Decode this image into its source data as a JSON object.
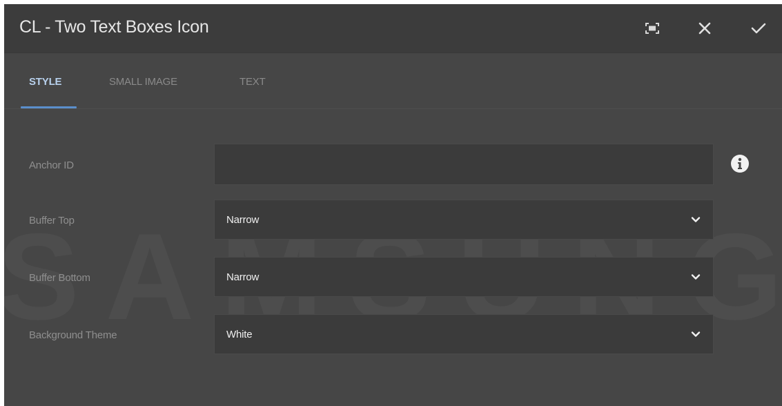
{
  "dialog": {
    "title": "CL - Two Text Boxes Icon",
    "actions": [
      {
        "name": "fullscreen",
        "icon": "fullscreen-icon"
      },
      {
        "name": "close",
        "icon": "close-icon"
      },
      {
        "name": "done",
        "icon": "checkmark-icon"
      }
    ]
  },
  "tabs": [
    {
      "label": "STYLE",
      "active": true
    },
    {
      "label": "SMALL IMAGE",
      "active": false
    },
    {
      "label": "TEXT",
      "active": false
    }
  ],
  "form": {
    "anchor_id": {
      "label": "Anchor ID",
      "value": "",
      "info_icon": "info-icon"
    },
    "buffer_top": {
      "label": "Buffer Top",
      "value": "Narrow"
    },
    "buffer_bottom": {
      "label": "Buffer Bottom",
      "value": "Narrow"
    },
    "background_theme": {
      "label": "Background Theme",
      "value": "White"
    }
  },
  "watermark": "SAMSUNG",
  "colors": {
    "dialog_bg": "#464646",
    "titlebar_bg": "#3c3c3c",
    "field_bg": "#3b3b3b",
    "active_tab": "#b7d0ec",
    "tab_underline": "#5b8fcc"
  }
}
